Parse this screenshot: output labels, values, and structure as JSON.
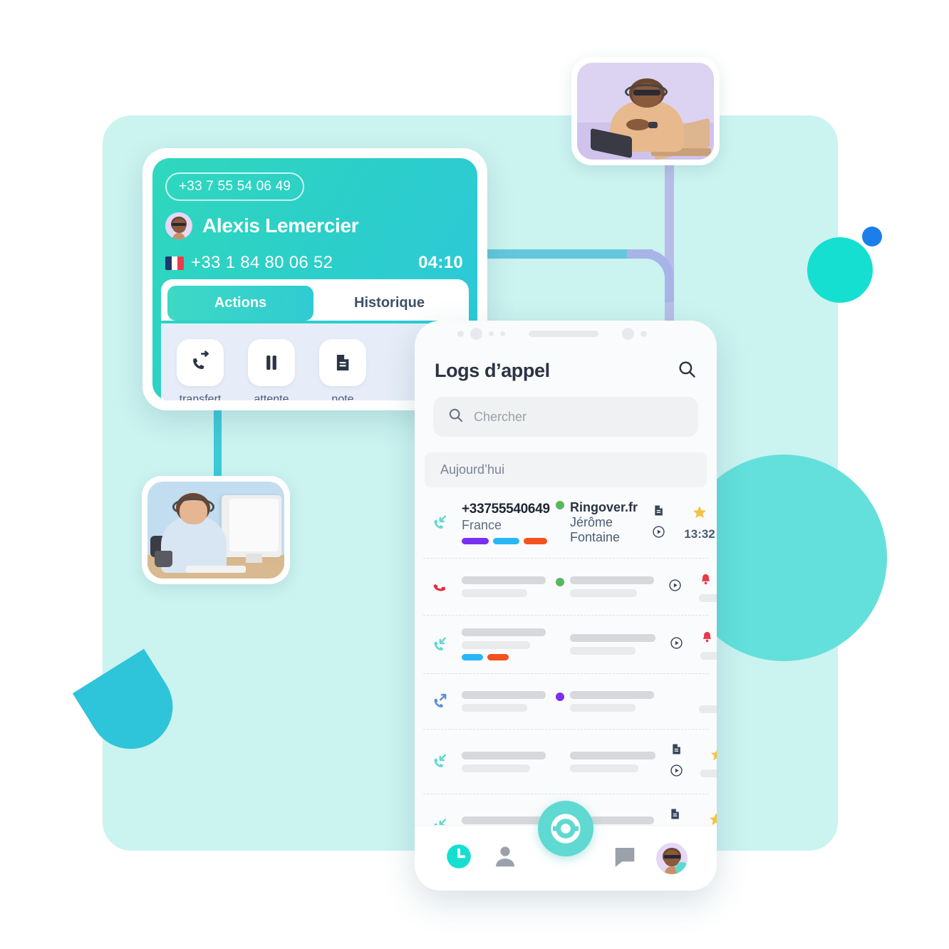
{
  "theme": {
    "panel_bg": "#CBF3F0",
    "teal": "#2CCFC8",
    "teal_light": "#5FD9D2",
    "teal_circle": "#63E0DC",
    "accent_blue": "#1B7FEB",
    "lavender_line": "#B7BDE8",
    "half_moon": "#2EC4D9",
    "star": "#F5C344",
    "bell": "#E8394B",
    "missed_red": "#E8283C"
  },
  "call_card": {
    "badge_number": "+33 7 55 54 06 49",
    "caller_name": "Alexis Lemercier",
    "avatar_name": "caller-avatar",
    "flag": "france-flag-icon",
    "line_number": "+33 1 84 80 06 52",
    "timer": "04:10",
    "tabs": [
      {
        "label": "Actions",
        "active": true
      },
      {
        "label": "Historique",
        "active": false
      }
    ],
    "actions": [
      {
        "label": "transfert",
        "icon": "call-transfer-icon"
      },
      {
        "label": "attente",
        "icon": "pause-icon"
      },
      {
        "label": "note",
        "icon": "note-document-icon"
      }
    ]
  },
  "phone": {
    "title": "Logs d’appel",
    "header_search_icon": "search-icon",
    "search": {
      "icon": "search-icon",
      "placeholder": "Chercher",
      "value": ""
    },
    "day_group": "Aujourd’hui",
    "rows": [
      {
        "direction_icon": "call-incoming-icon",
        "direction_color": "#5FD9D2",
        "number": "+33755540649",
        "country": "France",
        "tags": [
          "#7B2FF2",
          "#29B6F6",
          "#F4511E"
        ],
        "status_dot": "#57B860",
        "org": "Ringover.fr",
        "agent": "Jérôme Fontaine",
        "icons": [
          "note-document-icon",
          "play-circle-icon"
        ],
        "flags": [
          "star-icon"
        ],
        "time": "13:32",
        "placeholder": false
      },
      {
        "direction_icon": "call-missed-icon",
        "direction_color": "#E8283C",
        "status_dot": "#57B860",
        "icons": [
          "play-circle-icon"
        ],
        "flags": [
          "bell-icon",
          "star-icon"
        ],
        "tags": [],
        "placeholder": true
      },
      {
        "direction_icon": "call-incoming-icon",
        "direction_color": "#5FD9D2",
        "status_dot": null,
        "icons": [
          "play-circle-icon"
        ],
        "flags": [
          "bell-icon",
          "star-icon"
        ],
        "tags": [
          "#29B6F6",
          "#F4511E"
        ],
        "placeholder": true
      },
      {
        "direction_icon": "call-outgoing-icon",
        "direction_color": "#5A8FD6",
        "status_dot": "#7B2FF2",
        "icons": [],
        "flags": [],
        "tags": [],
        "placeholder": true
      },
      {
        "direction_icon": "call-incoming-icon",
        "direction_color": "#5FD9D2",
        "status_dot": null,
        "icons": [
          "note-document-icon",
          "play-circle-icon"
        ],
        "flags": [
          "star-icon"
        ],
        "tags": [],
        "placeholder": true
      },
      {
        "direction_icon": "call-incoming-icon",
        "direction_color": "#5FD9D2",
        "status_dot": "#57B860",
        "icons": [
          "note-document-icon",
          "play-circle-icon"
        ],
        "flags": [
          "star-icon"
        ],
        "tags": [],
        "placeholder": true
      }
    ],
    "bottom_nav": [
      {
        "icon": "clock-history-icon",
        "active": true
      },
      {
        "icon": "contacts-person-icon",
        "active": false
      },
      {
        "icon": "ringover-dial-icon",
        "active": false,
        "is_fab": true
      },
      {
        "icon": "chat-bubble-icon",
        "active": false
      },
      {
        "icon": "profile-avatar",
        "active": false
      }
    ]
  },
  "photos": [
    {
      "name": "agent-photo-top",
      "bg": "#DCD2F2"
    },
    {
      "name": "agent-photo-left",
      "bg": "#C3DDF0"
    }
  ]
}
